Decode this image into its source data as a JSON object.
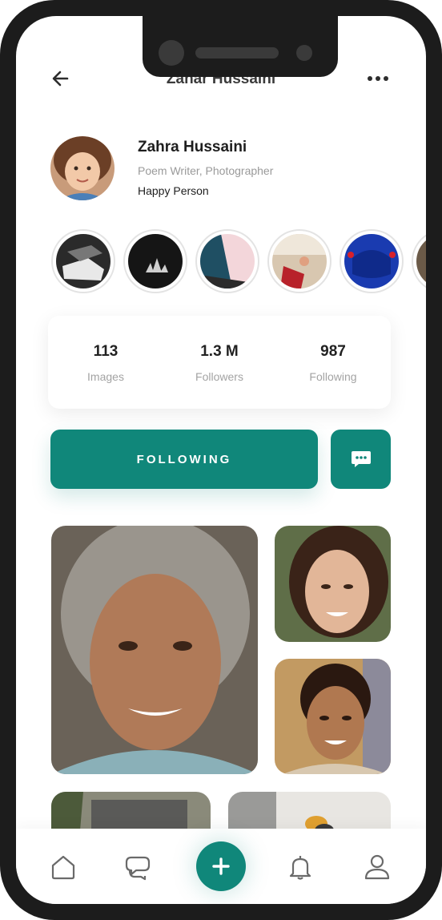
{
  "header": {
    "title": "Zahar Hussaini",
    "back_icon": "arrow-left-icon",
    "more_icon": "more-horizontal-icon"
  },
  "profile": {
    "name": "Zahra Hussaini",
    "role": "Poem Writer, Photographer",
    "tagline": "Happy Person"
  },
  "stories": [
    {
      "icon": "story-thumbnail-shoes"
    },
    {
      "icon": "story-thumbnail-adidas"
    },
    {
      "icon": "story-thumbnail-pink"
    },
    {
      "icon": "story-thumbnail-room"
    },
    {
      "icon": "story-thumbnail-blue"
    },
    {
      "icon": "story-thumbnail-partial"
    }
  ],
  "stats": [
    {
      "value": "113",
      "label": "Images"
    },
    {
      "value": "1.3 M",
      "label": "Followers"
    },
    {
      "value": "987",
      "label": "Following"
    }
  ],
  "actions": {
    "follow_label": "FOLLOWING",
    "message_icon": "chat-bubble-icon"
  },
  "bottom_nav": {
    "items": [
      "home-icon",
      "chat-icon",
      "plus-icon",
      "bell-icon",
      "user-icon"
    ]
  },
  "colors": {
    "accent": "#10877a",
    "text": "#1e1e1e",
    "muted": "#9a9a9a"
  }
}
